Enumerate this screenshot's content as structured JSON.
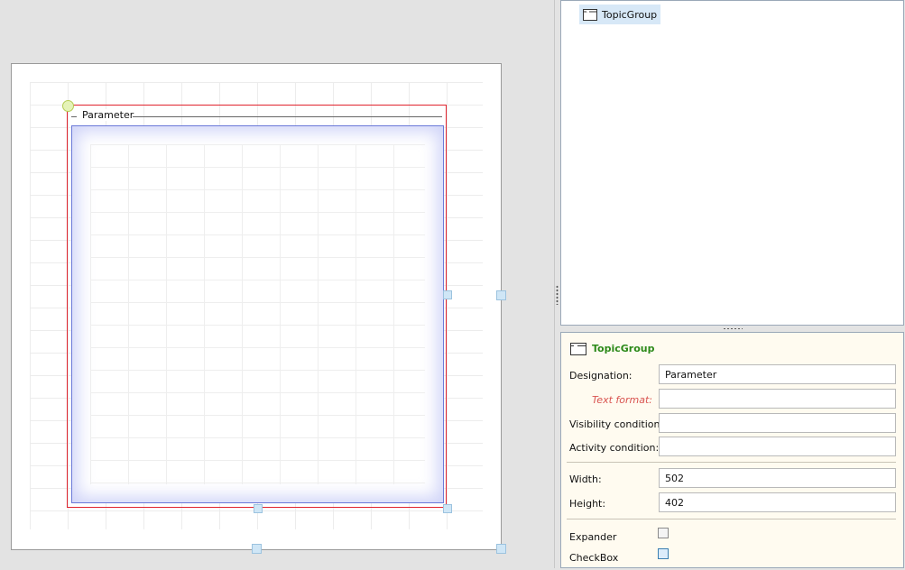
{
  "designer": {
    "topic_group_title": "Parameter"
  },
  "tree": {
    "root_label": "TopicGroup",
    "root_icon": "topic-group-icon"
  },
  "properties": {
    "header_title": "TopicGroup",
    "header_icon": "topic-group-icon",
    "designation_label": "Designation:",
    "designation_value": "Parameter",
    "text_format_label": "Text format:",
    "text_format_value": "",
    "visibility_label": "Visibility condition:",
    "visibility_value": "",
    "activity_label": "Activity condition:",
    "activity_value": "",
    "width_label": "Width:",
    "width_value": "502",
    "height_label": "Height:",
    "height_value": "402",
    "expander_label": "Expander",
    "expander_checked": false,
    "checkbox_label": "CheckBox",
    "checkbox_checked": false
  },
  "colors": {
    "selection_border": "#e0242e",
    "inner_border": "#6b7ad8",
    "properties_title": "#2d8a1a",
    "text_format_label": "#d9534f",
    "tree_selection": "#d7e8f7",
    "properties_background": "#fffbf0"
  }
}
